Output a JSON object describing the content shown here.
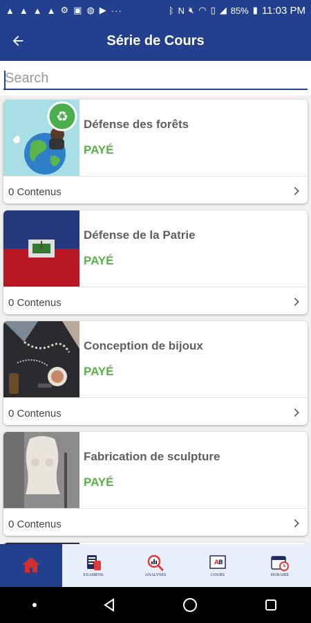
{
  "status_bar": {
    "battery": "85%",
    "time": "11:03 PM",
    "left_icons": [
      "notification-a-icon",
      "notification-a-icon",
      "notification-a-icon",
      "notification-a-icon",
      "notification-a-icon",
      "settings-icon",
      "image-icon",
      "globe-icon",
      "youtube-icon",
      "more-icon"
    ],
    "right_icons": [
      "bluetooth-icon",
      "nfc-icon",
      "mute-icon",
      "wifi-icon",
      "sim-icon",
      "signal-icon",
      "battery-icon"
    ]
  },
  "app_bar": {
    "title": "Série de Cours",
    "back_icon": "back-arrow-icon"
  },
  "search": {
    "placeholder": "Search",
    "value": ""
  },
  "courses": [
    {
      "title": "Défense des forêts",
      "status": "PAYÉ",
      "count": "0 Contenus",
      "thumb": "earth-recycle"
    },
    {
      "title": "Défense de la Patrie",
      "status": "PAYÉ",
      "count": "0 Contenus",
      "thumb": "haiti-flag"
    },
    {
      "title": "Conception de bijoux",
      "status": "PAYÉ",
      "count": "0 Contenus",
      "thumb": "jewelry"
    },
    {
      "title": "Fabrication de sculpture",
      "status": "PAYÉ",
      "count": "0 Contenus",
      "thumb": "torso-sculpture"
    }
  ],
  "bottom_nav": [
    {
      "label": "",
      "icon": "home-icon",
      "active": true
    },
    {
      "label": "EXAMENS",
      "icon": "exams-icon",
      "active": false
    },
    {
      "label": "ANALYSES",
      "icon": "analysis-icon",
      "active": false
    },
    {
      "label": "COURS",
      "icon": "course-icon",
      "active": false
    },
    {
      "label": "HORAIRE",
      "icon": "calendar-icon",
      "active": false
    }
  ],
  "colors": {
    "primary": "#23408f",
    "paid_green": "#5ab04a",
    "nav_bg": "#e8effa",
    "home_red": "#d32f2f"
  }
}
